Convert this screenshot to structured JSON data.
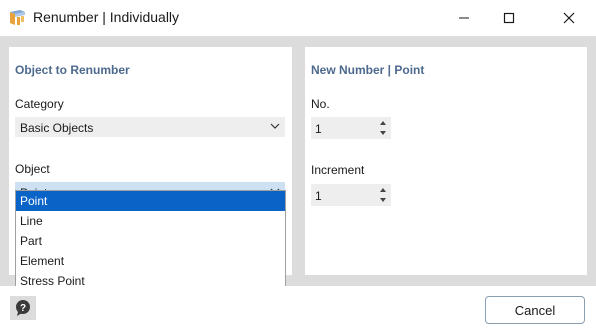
{
  "window": {
    "title": "Renumber | Individually",
    "icon": "renumber-app-icon"
  },
  "left_panel": {
    "title": "Object to Renumber",
    "category_label": "Category",
    "category_value": "Basic Objects",
    "object_label": "Object",
    "object_value": "Point",
    "object_options": [
      "Point",
      "Line",
      "Part",
      "Element",
      "Stress Point"
    ],
    "object_selected_index": 0
  },
  "right_panel": {
    "title": "New Number | Point",
    "no_label": "No.",
    "no_value": "1",
    "increment_label": "Increment",
    "increment_value": "1"
  },
  "footer": {
    "help_icon": "help-icon",
    "cancel_label": "Cancel"
  },
  "colors": {
    "panel_title": "#4d6a8e",
    "selection": "#0a64c8",
    "open_combo": "#cde1f3",
    "background": "#dcdcdc"
  }
}
